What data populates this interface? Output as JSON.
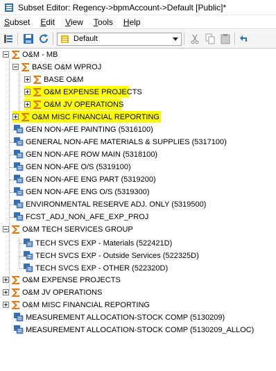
{
  "window": {
    "title": "Subset Editor:  Regency->bpmAccount->Default  [Public]*"
  },
  "menu": {
    "items": [
      "Subset",
      "Edit",
      "View",
      "Tools",
      "Help"
    ],
    "underline": [
      "S",
      "E",
      "V",
      "T",
      "H"
    ]
  },
  "toolbar": {
    "subset_value": "Default"
  },
  "tree": {
    "om_mb": "O&M - MB",
    "base_om_wproj": "BASE O&M WPROJ",
    "base_om": "BASE O&M",
    "om_expense_projects_1": "O&M EXPENSE PROJECTS",
    "om_jv_operations_1": "O&M JV OPERATIONS",
    "om_misc_fin_1": "O&M MISC FINANCIAL REPORTING",
    "gen_painting": "GEN NON-AFE PAINTING (5316100)",
    "general_materials": "GENERAL NON-AFE MATERIALS & SUPPLIES (5317100)",
    "gen_row_main": "GEN NON-AFE ROW MAIN (5318100)",
    "gen_os": "GEN NON-AFE O/S (5319100)",
    "gen_eng_part": "GEN NON-AFE ENG PART (5319200)",
    "gen_eng_os": "GEN NON-AFE ENG O/S (5319300)",
    "env_reserve": "ENVIRONMENTAL RESERVE ADJ. ONLY (5319500)",
    "fcst_adj": "FCST_ADJ_NON_AFE_EXP_PROJ",
    "om_tech_services": "O&M TECH SERVICES GROUP",
    "tech_materials": "TECH SVCS EXP - Materials (522421D)",
    "tech_outside": "TECH SVCS EXP - Outside Services (522325D)",
    "tech_other": "TECH SVCS EXP - OTHER (522320D)",
    "om_expense_projects_2": "O&M EXPENSE PROJECTS",
    "om_jv_operations_2": "O&M JV OPERATIONS",
    "om_misc_fin_2": "O&M MISC FINANCIAL REPORTING",
    "measurement_stock": "MEASUREMENT ALLOCATION-STOCK COMP (5130209)",
    "measurement_alloc": "MEASUREMENT ALLOCATION-STOCK COMP (5130209_ALLOC)"
  },
  "colors": {
    "highlight": "#ffff00",
    "sigma": "#e07a10",
    "leaf_icon": "#3a6fb0"
  }
}
